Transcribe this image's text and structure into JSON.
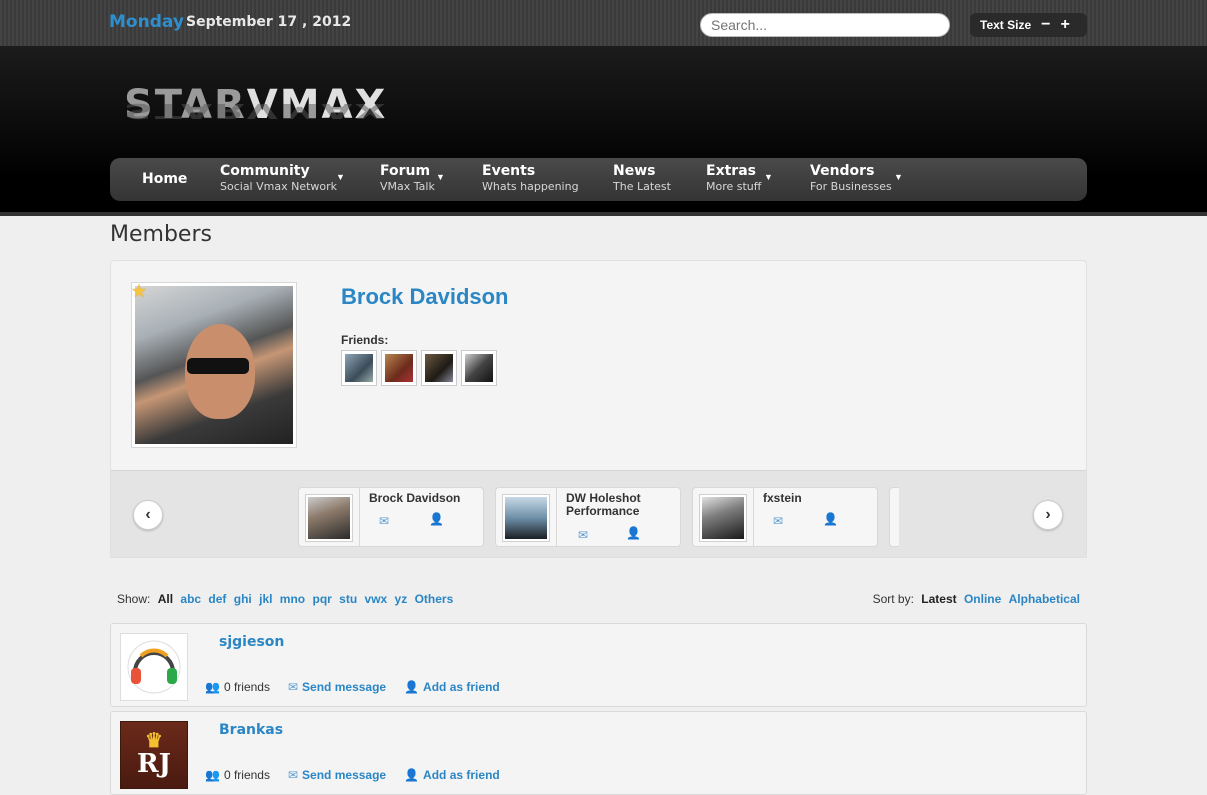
{
  "topbar": {
    "day": "Monday",
    "date": "September 17 , 2012",
    "search_placeholder": "Search...",
    "text_size_label": "Text Size",
    "text_size_minus": "−",
    "text_size_plus": "+"
  },
  "logo": {
    "part1": "STAR",
    "part2": "VMAX"
  },
  "nav": [
    {
      "title": "Home",
      "subtitle": ""
    },
    {
      "title": "Community",
      "subtitle": "Social Vmax Network",
      "has_dropdown": true
    },
    {
      "title": "Forum",
      "subtitle": "VMax Talk",
      "has_dropdown": true
    },
    {
      "title": "Events",
      "subtitle": "Whats happening"
    },
    {
      "title": "News",
      "subtitle": "The Latest"
    },
    {
      "title": "Extras",
      "subtitle": "More stuff",
      "has_dropdown": true
    },
    {
      "title": "Vendors",
      "subtitle": "For Businesses",
      "has_dropdown": true
    }
  ],
  "page": {
    "title": "Members"
  },
  "profile": {
    "name": "Brock Davidson",
    "friends_label": "Friends:",
    "featured_icon": "star-icon"
  },
  "carousel": {
    "prev_icon": "chevron-left-icon",
    "next_icon": "chevron-right-icon",
    "cards": [
      {
        "name": "Brock Davidson"
      },
      {
        "name": "DW Holeshot Performance"
      },
      {
        "name": "fxstein"
      }
    ]
  },
  "filter": {
    "show_label": "Show:",
    "options": [
      "All",
      "abc",
      "def",
      "ghi",
      "jkl",
      "mno",
      "pqr",
      "stu",
      "vwx",
      "yz",
      "Others"
    ],
    "active": "All",
    "sort_label": "Sort by:",
    "sort_options": [
      "Latest",
      "Online",
      "Alphabetical"
    ],
    "sort_active": "Latest"
  },
  "members": [
    {
      "username": "sjgieson",
      "friends": "0 friends",
      "send_message": "Send message",
      "add_friend": "Add as friend"
    },
    {
      "username": "Brankas",
      "friends": "0 friends",
      "send_message": "Send message",
      "add_friend": "Add as friend",
      "avatar_text": "RJ"
    }
  ],
  "colors": {
    "link": "#2a86c4",
    "day": "#2d8fd0",
    "nav_bg": "#3f3f3f"
  }
}
